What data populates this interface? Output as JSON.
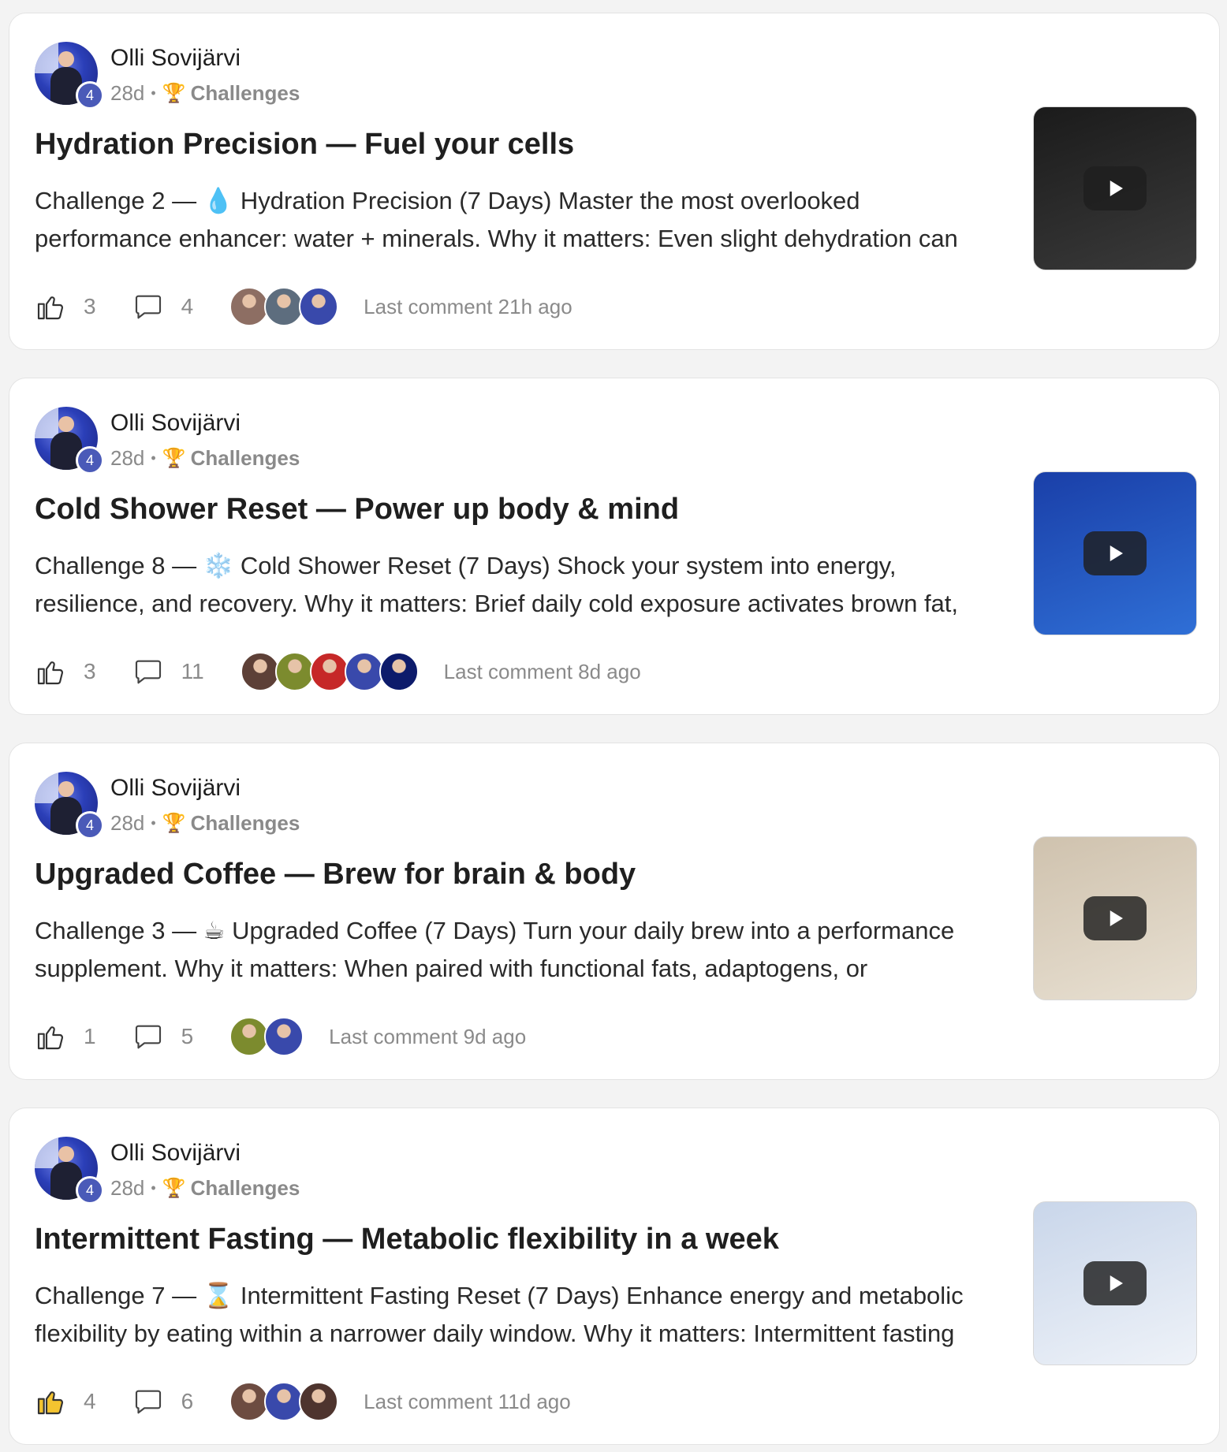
{
  "posts": [
    {
      "author": "Olli Sovijärvi",
      "level": "4",
      "time": "28d",
      "separator": "•",
      "category_icon": "trophy-icon",
      "category": "Challenges",
      "title": "Hydration Precision — Fuel your cells",
      "excerpt_lines": [
        "Challenge 2 — 💧 Hydration Precision (7 Days) Master the most overlooked",
        "performance enhancer: water + minerals. Why it matters: Even slight dehydration can"
      ],
      "likes": "3",
      "liked": false,
      "comments": "4",
      "commenter_colors": [
        "#8d6e63",
        "#5d6d7e",
        "#3949ab"
      ],
      "last_comment": "Last comment 21h ago",
      "thumbnail_colors": [
        "#1b1b1b",
        "#3a3a3a"
      ]
    },
    {
      "author": "Olli Sovijärvi",
      "level": "4",
      "time": "28d",
      "separator": "•",
      "category_icon": "trophy-icon",
      "category": "Challenges",
      "title": "Cold Shower Reset — Power up body & mind",
      "excerpt_lines": [
        "Challenge 8 — ❄️ Cold Shower Reset (7 Days) Shock your system into energy,",
        "resilience, and recovery. Why it matters: Brief daily cold exposure activates brown fat,"
      ],
      "likes": "3",
      "liked": false,
      "comments": "11",
      "commenter_colors": [
        "#5d4037",
        "#7c8b2e",
        "#c62828",
        "#3949ab",
        "#0d1b6b"
      ],
      "last_comment": "Last comment 8d ago",
      "thumbnail_colors": [
        "#1a3fa8",
        "#2f6fd6"
      ]
    },
    {
      "author": "Olli Sovijärvi",
      "level": "4",
      "time": "28d",
      "separator": "•",
      "category_icon": "trophy-icon",
      "category": "Challenges",
      "title": "Upgraded Coffee — Brew for brain & body",
      "excerpt_lines": [
        "Challenge 3 — ☕ Upgraded Coffee (7 Days) Turn your daily brew into a performance",
        "supplement. Why it matters: When paired with functional fats, adaptogens, or"
      ],
      "likes": "1",
      "liked": false,
      "comments": "5",
      "commenter_colors": [
        "#7c8b2e",
        "#3949ab"
      ],
      "last_comment": "Last comment 9d ago",
      "thumbnail_colors": [
        "#cfc2ae",
        "#e8e0d2"
      ]
    },
    {
      "author": "Olli Sovijärvi",
      "level": "4",
      "time": "28d",
      "separator": "•",
      "category_icon": "trophy-icon",
      "category": "Challenges",
      "title": "Intermittent Fasting — Metabolic flexibility in a week",
      "excerpt_lines": [
        "Challenge 7 — ⌛ Intermittent Fasting Reset (7 Days) Enhance energy and metabolic",
        "flexibility by eating within a narrower daily window. Why it matters: Intermittent fasting"
      ],
      "likes": "4",
      "liked": true,
      "comments": "6",
      "commenter_colors": [
        "#6d4c41",
        "#3949ab",
        "#4e342e"
      ],
      "last_comment": "Last comment 11d ago",
      "thumbnail_colors": [
        "#c9d6ea",
        "#eef2f8"
      ]
    }
  ],
  "colors": {
    "level_badge": "#4a5ab8",
    "liked_icon_fill": "#f4c430",
    "muted_text": "#8a8a8a"
  }
}
